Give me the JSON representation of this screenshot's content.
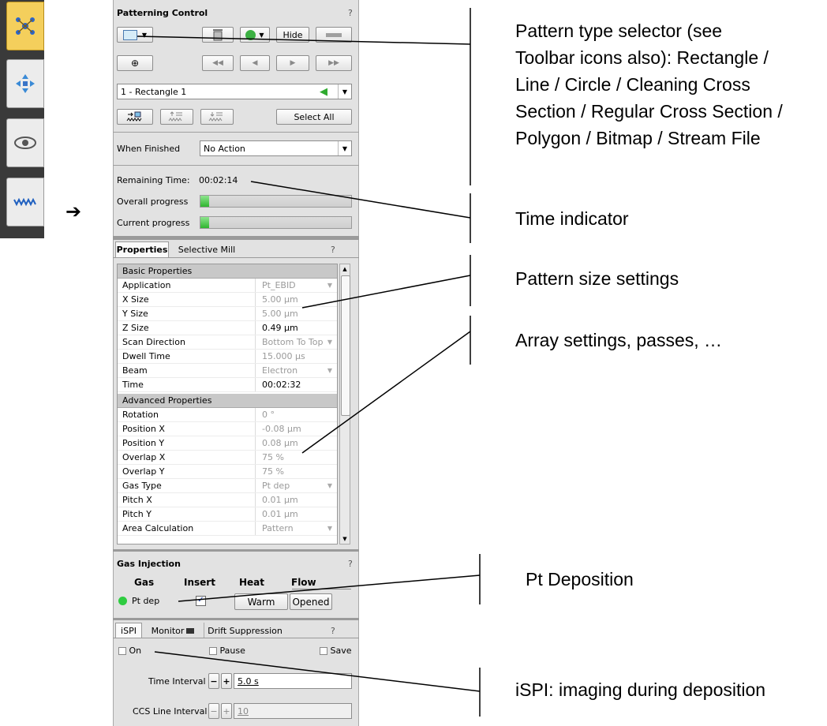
{
  "toolbar": {
    "icons": [
      "molecule-icon",
      "move-arrows-icon",
      "eye-icon",
      "pattern-wave-icon"
    ],
    "active_index": 0,
    "pointer": "➔"
  },
  "patterning": {
    "title": "Patterning Control",
    "help": "?",
    "hide_label": "Hide",
    "pattern_name": "1 - Rectangle 1",
    "select_all_label": "Select All",
    "when_finished_label": "When Finished",
    "when_finished_value": "No Action",
    "remaining_time_label": "Remaining Time:",
    "remaining_time_value": "00:02:14",
    "overall_progress_label": "Overall progress",
    "overall_progress": 0.06,
    "current_progress_label": "Current progress",
    "current_progress": 0.06
  },
  "properties": {
    "tabs": [
      "Properties",
      "Selective Mill"
    ],
    "help": "?",
    "basic_title": "Basic Properties",
    "basic_rows": [
      {
        "k": "Application",
        "v": "Pt_EBID",
        "dd": true,
        "enabled": false
      },
      {
        "k": "X Size",
        "v": "5.00 µm",
        "dd": false,
        "enabled": false
      },
      {
        "k": "Y Size",
        "v": "5.00 µm",
        "dd": false,
        "enabled": false
      },
      {
        "k": "Z Size",
        "v": "0.49 µm",
        "dd": false,
        "enabled": true
      },
      {
        "k": "Scan Direction",
        "v": "Bottom To Top",
        "dd": true,
        "enabled": false
      },
      {
        "k": "Dwell Time",
        "v": "15.000 µs",
        "dd": false,
        "enabled": false
      },
      {
        "k": "Beam",
        "v": "Electron",
        "dd": true,
        "enabled": false
      },
      {
        "k": "Time",
        "v": "00:02:32",
        "dd": false,
        "enabled": true
      }
    ],
    "advanced_title": "Advanced Properties",
    "advanced_rows": [
      {
        "k": "Rotation",
        "v": "0 °",
        "dd": false,
        "enabled": false
      },
      {
        "k": "Position X",
        "v": "-0.08 µm",
        "dd": false,
        "enabled": false
      },
      {
        "k": "Position Y",
        "v": "0.08 µm",
        "dd": false,
        "enabled": false
      },
      {
        "k": "Overlap X",
        "v": "75 %",
        "dd": false,
        "enabled": false
      },
      {
        "k": "Overlap Y",
        "v": "75 %",
        "dd": false,
        "enabled": false
      },
      {
        "k": "Gas Type",
        "v": "Pt dep",
        "dd": true,
        "enabled": false
      },
      {
        "k": "Pitch X",
        "v": "0.01 µm",
        "dd": false,
        "enabled": false
      },
      {
        "k": "Pitch Y",
        "v": "0.01 µm",
        "dd": false,
        "enabled": false
      },
      {
        "k": "Area Calculation",
        "v": "Pattern",
        "dd": true,
        "enabled": false
      }
    ]
  },
  "gas": {
    "title": "Gas Injection",
    "help": "?",
    "headers": [
      "Gas",
      "Insert",
      "Heat",
      "Flow"
    ],
    "gas_name": "Pt dep",
    "heat_label": "Warm",
    "flow_label": "Opened",
    "status_color": "#2ecc40"
  },
  "ispi": {
    "tabs": [
      "iSPI",
      "Monitor",
      "Drift Suppression"
    ],
    "help": "?",
    "on_label": "On",
    "pause_label": "Pause",
    "save_label": "Save",
    "time_interval_label": "Time Interval",
    "time_interval_value": "5.0 s",
    "ccs_label": "CCS Line Interval",
    "ccs_value": "10"
  },
  "annotations": {
    "pattern_type": [
      "Pattern type selector (see",
      "Toolbar icons also): Rectangle /",
      "Line / Circle / Cleaning Cross",
      "Section / Regular Cross Section /",
      "Polygon / Bitmap / Stream File"
    ],
    "time": "Time indicator",
    "size": "Pattern size settings",
    "array": "Array settings, passes, …",
    "pt": "Pt Deposition",
    "ispi": "iSPI: imaging during deposition"
  }
}
